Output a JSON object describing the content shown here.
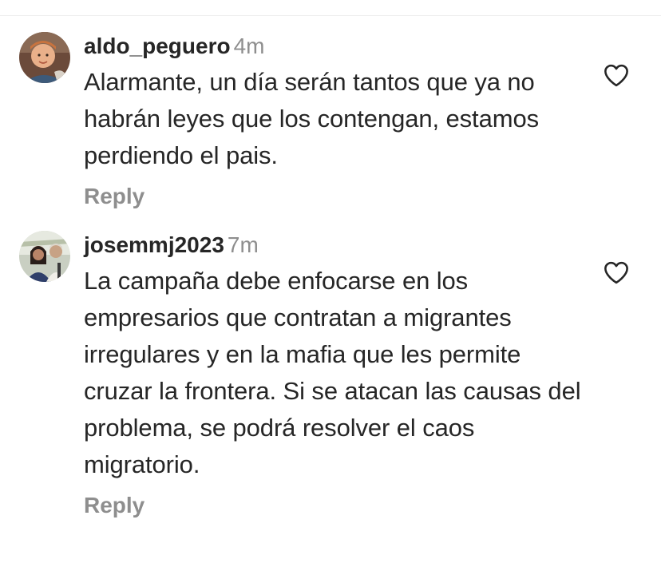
{
  "comments": [
    {
      "username": "aldo_peguero",
      "time": "4m",
      "text": "Alarmante, un día serán tantos que ya no habrán leyes que los contengan, estamos perdiendo el pais.",
      "reply_label": "Reply",
      "avatar_icon": "user-photo-avatar",
      "like_icon": "heart-outline-icon"
    },
    {
      "username": "josemmj2023",
      "time": "7m",
      "text": "La campaña debe enfocarse en los empresarios que contratan a migrantes irregulares y en la mafia que les permite cruzar la frontera. Si se atacan las causas del problema, se podrá resolver el caos migratorio.",
      "reply_label": "Reply",
      "avatar_icon": "user-photo-avatar",
      "like_icon": "heart-outline-icon"
    }
  ],
  "colors": {
    "text": "#262626",
    "secondary": "#8e8e8e",
    "background": "#ffffff"
  }
}
